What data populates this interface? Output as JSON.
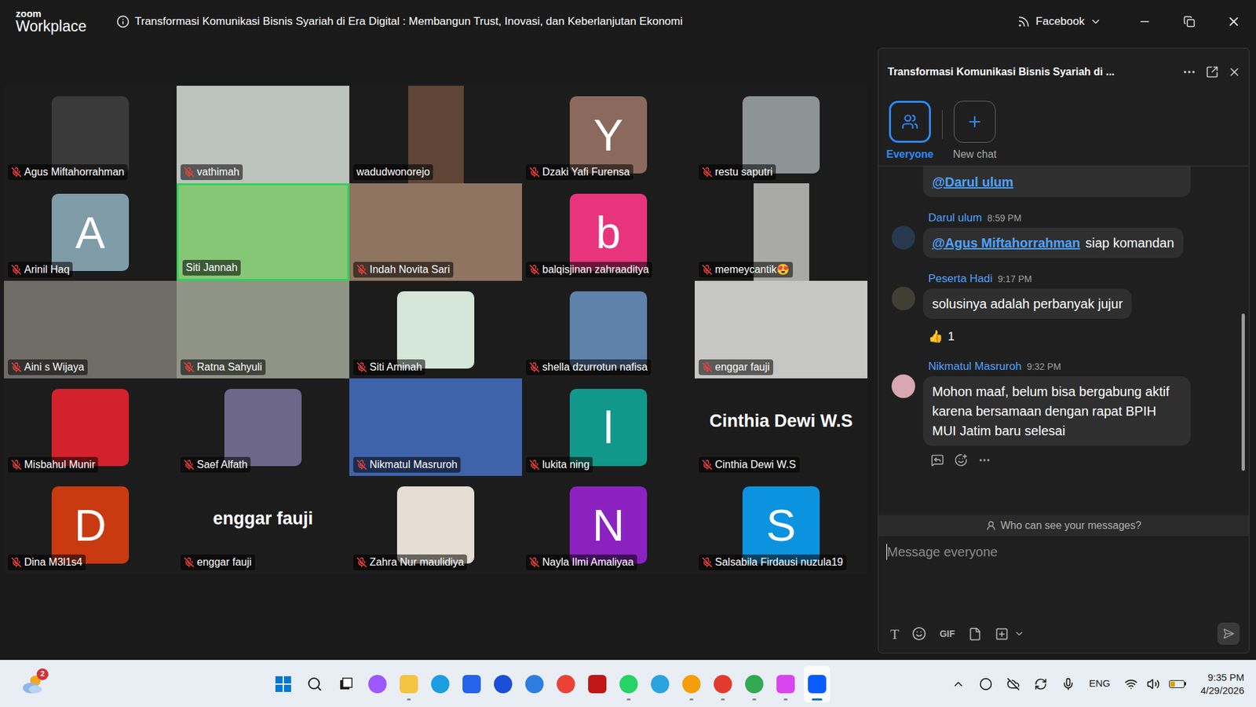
{
  "window": {
    "logo_top": "zoom",
    "logo_bottom": "Workplace",
    "title": "Transformasi Komunikasi Bisnis Syariah di Era Digital : Membangun Trust, Inovasi, dan Keberlanjutan Ekonomi",
    "live_target": "Facebook"
  },
  "participants": [
    {
      "name": "Agus Miftahorrahman",
      "kind": "photo",
      "muted": true,
      "speaking": false,
      "color": "#3a3a3a"
    },
    {
      "name": "vathimah",
      "kind": "video",
      "muted": true,
      "speaking": false,
      "color": "#bcc3bd"
    },
    {
      "name": "wadudwonorejo",
      "kind": "portrait",
      "muted": false,
      "speaking": false,
      "color": "#5e4536"
    },
    {
      "name": "Dzaki Yafi Furensa",
      "kind": "avatar",
      "letter": "Y",
      "muted": true,
      "speaking": false,
      "color": "#8b6a5d"
    },
    {
      "name": "restu saputri",
      "kind": "photo",
      "muted": true,
      "speaking": false,
      "color": "#8d9495"
    },
    {
      "name": "Arinil Haq",
      "kind": "avatar",
      "letter": "A",
      "muted": true,
      "speaking": false,
      "color": "#7f9ca8"
    },
    {
      "name": "Siti Jannah",
      "kind": "video",
      "muted": false,
      "speaking": true,
      "color": "#86c776"
    },
    {
      "name": "Indah Novita Sari",
      "kind": "video",
      "muted": true,
      "speaking": false,
      "color": "#8e7461"
    },
    {
      "name": "balqisjinan zahraaditya",
      "kind": "avatar",
      "letter": "b",
      "muted": true,
      "speaking": false,
      "color": "#e8347d"
    },
    {
      "name": "memeycantik😍",
      "kind": "portrait",
      "muted": true,
      "speaking": false,
      "color": "#a9aaa5"
    },
    {
      "name": "Aini s Wijaya",
      "kind": "video",
      "muted": true,
      "speaking": false,
      "color": "#6f6b67"
    },
    {
      "name": "Ratna Sahyuli",
      "kind": "video",
      "muted": true,
      "speaking": false,
      "color": "#8f9486"
    },
    {
      "name": "Siti Aminah",
      "kind": "photo",
      "muted": true,
      "speaking": false,
      "color": "#d5e6da"
    },
    {
      "name": "shella dzurrotun nafisa",
      "kind": "photo",
      "muted": true,
      "speaking": false,
      "color": "#5f82aa"
    },
    {
      "name": "enggar fauji",
      "kind": "video",
      "muted": true,
      "speaking": false,
      "color": "#c6c6c4"
    },
    {
      "name": "Misbahul Munir",
      "kind": "photo",
      "muted": true,
      "speaking": false,
      "color": "#d3222b"
    },
    {
      "name": "Saef Alfath",
      "kind": "photo",
      "muted": true,
      "speaking": false,
      "color": "#6d6889"
    },
    {
      "name": "Nikmatul Masruroh",
      "kind": "video",
      "muted": true,
      "speaking": false,
      "color": "#3f63aa"
    },
    {
      "name": "lukita ning",
      "kind": "avatar",
      "letter": "l",
      "muted": true,
      "speaking": false,
      "color": "#12988a"
    },
    {
      "name": "Cinthia Dewi W.S",
      "kind": "name",
      "muted": true,
      "speaking": false
    },
    {
      "name": "Dina M3l1s4",
      "kind": "avatar",
      "letter": "D",
      "muted": true,
      "speaking": false,
      "color": "#c93a10"
    },
    {
      "name": "enggar fauji",
      "kind": "name",
      "muted": true,
      "speaking": false
    },
    {
      "name": "Zahra Nur maulidiya",
      "kind": "photo",
      "muted": true,
      "speaking": false,
      "color": "#e6ddd2"
    },
    {
      "name": "Nayla Ilmi Amaliyaa",
      "kind": "avatar",
      "letter": "N",
      "muted": true,
      "speaking": false,
      "color": "#8b22c0"
    },
    {
      "name": "Salsabila Firdausi nuzula19",
      "kind": "avatar",
      "letter": "S",
      "muted": true,
      "speaking": false,
      "color": "#0c93df"
    }
  ],
  "chat": {
    "title": "Transformasi Komunikasi Bisnis Syariah di ...",
    "tabs": [
      {
        "label": "Everyone",
        "selected": true
      },
      {
        "label": "New chat",
        "selected": false
      }
    ],
    "cut_message": {
      "mention": "@Darul ulum"
    },
    "messages": [
      {
        "sender": "Darul ulum",
        "time": "8:59 PM",
        "mention": "@Agus Miftahorrahman",
        "text": "siap komandan",
        "avatar_color": "#26394d",
        "reactions": [],
        "hovered": false
      },
      {
        "sender": "Peserta Hadi",
        "time": "9:17 PM",
        "mention": "",
        "text": "solusinya adalah perbanyak jujur",
        "avatar_color": "#3f3f35",
        "reactions": [
          {
            "emoji": "👍",
            "count": "1"
          }
        ],
        "hovered": false
      },
      {
        "sender": "Nikmatul Masruroh",
        "time": "9:32 PM",
        "mention": "",
        "text": "Mohon maaf, belum bisa bergabung aktif karena bersamaan dengan rapat BPIH MUI Jatim baru selesai",
        "avatar_color": "#d9a6b3",
        "reactions": [],
        "hovered": true
      }
    ],
    "privacy_hint": "Who can see your messages?",
    "input_placeholder": "Message everyone",
    "tools": {
      "text_format": "T",
      "gif": "GIF"
    }
  },
  "taskbar": {
    "weather_badge": "2",
    "apps": [
      {
        "kind": "start",
        "running": false,
        "active": false
      },
      {
        "kind": "search",
        "running": false,
        "active": false
      },
      {
        "kind": "taskview",
        "running": false,
        "active": false
      },
      {
        "kind": "app",
        "shape": "circle",
        "color": "#9b59ff",
        "running": false,
        "active": false
      },
      {
        "kind": "app",
        "shape": "square",
        "color": "#f4c542",
        "running": true,
        "active": false
      },
      {
        "kind": "app",
        "shape": "circle",
        "color": "#1b9de2",
        "running": false,
        "active": false
      },
      {
        "kind": "app",
        "shape": "square",
        "color": "#2563eb",
        "running": false,
        "active": false
      },
      {
        "kind": "app",
        "shape": "circle",
        "color": "#1a4fd6",
        "running": false,
        "active": false
      },
      {
        "kind": "app",
        "shape": "circle",
        "color": "#2e7de1",
        "running": false,
        "active": false
      },
      {
        "kind": "app",
        "shape": "circle",
        "color": "#ea4335",
        "running": false,
        "active": false
      },
      {
        "kind": "app",
        "shape": "square",
        "color": "#c01818",
        "running": false,
        "active": false
      },
      {
        "kind": "app",
        "shape": "circle",
        "color": "#25d366",
        "running": true,
        "active": false
      },
      {
        "kind": "app",
        "shape": "circle",
        "color": "#2aa3de",
        "running": false,
        "active": false
      },
      {
        "kind": "app",
        "shape": "circle",
        "color": "#f59e0b",
        "running": true,
        "active": false
      },
      {
        "kind": "app",
        "shape": "circle",
        "color": "#e23b2e",
        "running": true,
        "active": false
      },
      {
        "kind": "app",
        "shape": "circle",
        "color": "#34a853",
        "running": true,
        "active": false
      },
      {
        "kind": "app",
        "shape": "square",
        "color": "#d946ef",
        "running": true,
        "active": false
      },
      {
        "kind": "app",
        "shape": "square",
        "color": "#0b5cff",
        "running": true,
        "active": true
      }
    ],
    "language": "ENG",
    "time": "9:35 PM",
    "date": "4/29/2026",
    "battery_level": 0.35
  }
}
